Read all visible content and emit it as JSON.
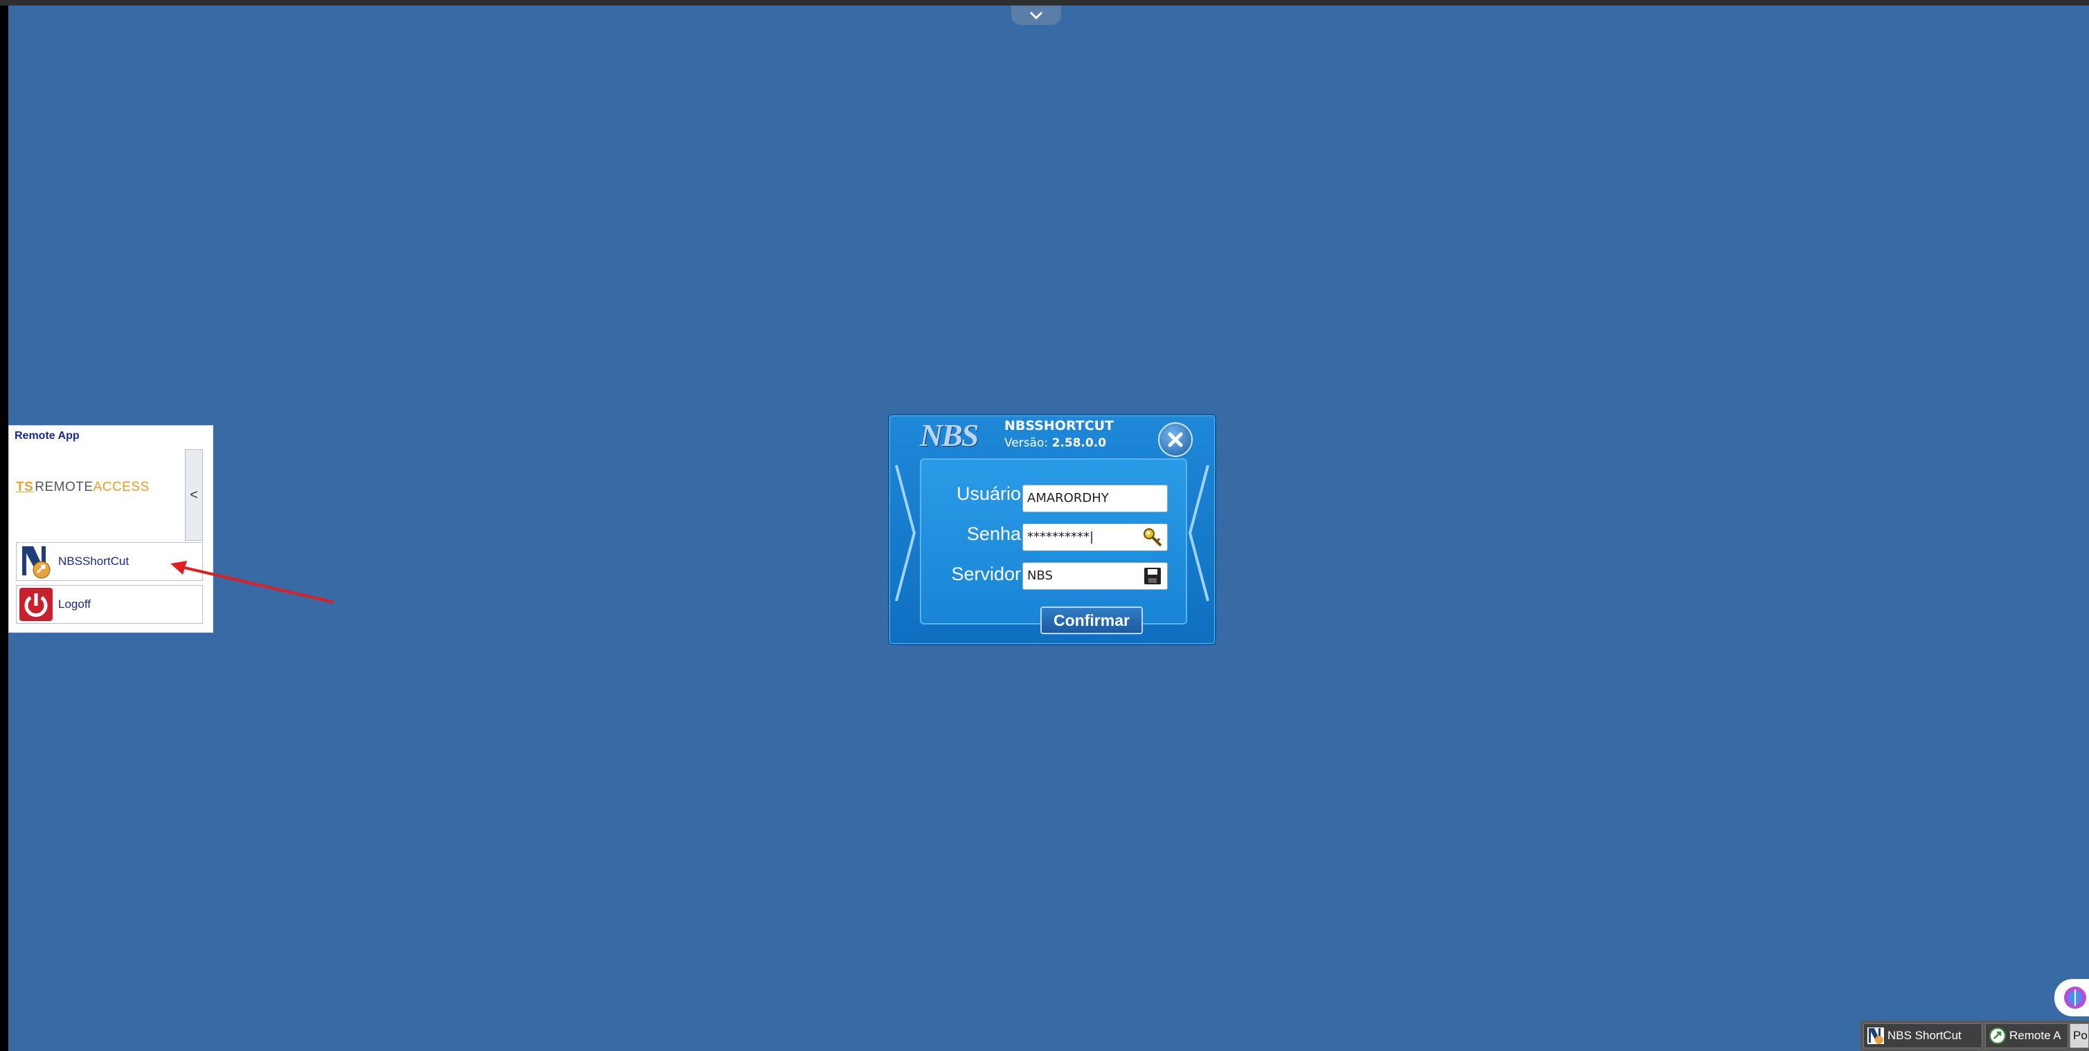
{
  "remote_app": {
    "title": "Remote App",
    "logo": {
      "ts": "TS",
      "remote": "REMOTE",
      "access": "ACCESS"
    },
    "collapse_glyph": "<",
    "items": [
      {
        "label": "NBSShortCut",
        "icon": "nbs-shortcut-icon"
      },
      {
        "label": "Logoff",
        "icon": "power-icon"
      }
    ]
  },
  "dialog": {
    "logo_text": "NBS",
    "app_title": "NBSSHORTCUT",
    "version_label": "Versão:",
    "version_value": "2.58.0.0",
    "fields": {
      "user_label": "Usuário",
      "user_value": "AMARORDHY",
      "password_label": "Senha",
      "password_value": "**********|",
      "server_label": "Servidor",
      "server_value": "NBS"
    },
    "confirm_label": "Confirmar"
  },
  "taskbar": {
    "items": [
      {
        "label": "NBS ShortCut"
      },
      {
        "label": "Remote A"
      },
      {
        "label": "Po"
      }
    ]
  },
  "colors": {
    "desktop": "#386aa6",
    "dialog_blue": "#1f88d8",
    "remote_title": "#1a2a8a",
    "access_orange": "#f39a1c",
    "arrow_red": "#e02020"
  }
}
